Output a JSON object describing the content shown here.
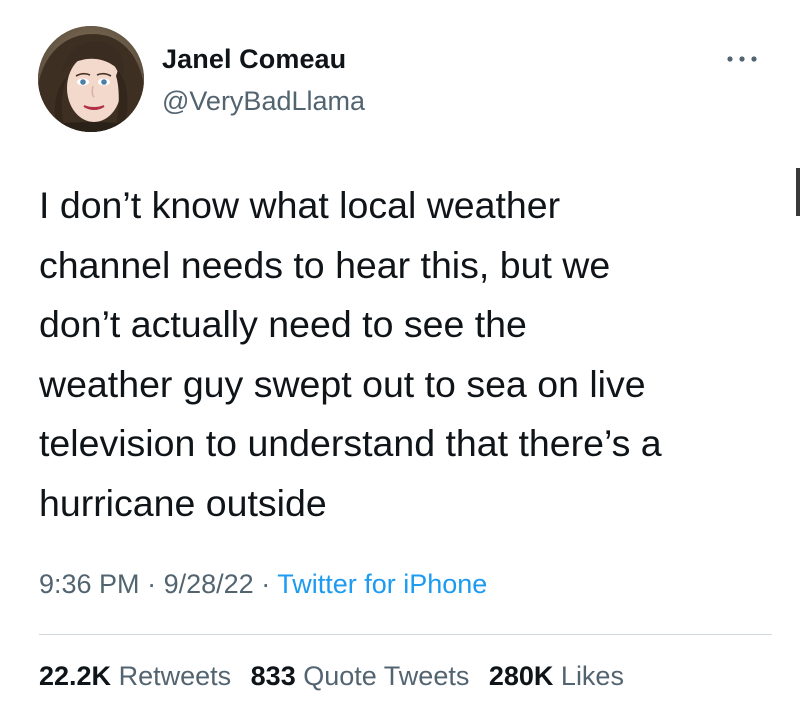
{
  "author": {
    "display_name": "Janel Comeau",
    "handle": "@VeryBadLlama"
  },
  "tweet": {
    "text_lines": [
      "I don’t know what local weather",
      "channel needs to hear this, but we",
      "don’t actually need to see the",
      "weather guy swept out to sea on live",
      "television to understand that there’s a",
      "hurricane outside"
    ],
    "time": "9:36 PM",
    "date": "9/28/22",
    "separator": "·",
    "source": "Twitter for iPhone"
  },
  "stats": {
    "retweets_count": "22.2K",
    "retweets_label": "Retweets",
    "quotes_count": "833",
    "quotes_label": "Quote Tweets",
    "likes_count": "280K",
    "likes_label": "Likes"
  },
  "icons": {
    "more": "more-horizontal-icon"
  },
  "colors": {
    "text": "#0f1419",
    "secondary": "#536471",
    "link": "#1d9bf0",
    "divider": "#cfd9de"
  }
}
